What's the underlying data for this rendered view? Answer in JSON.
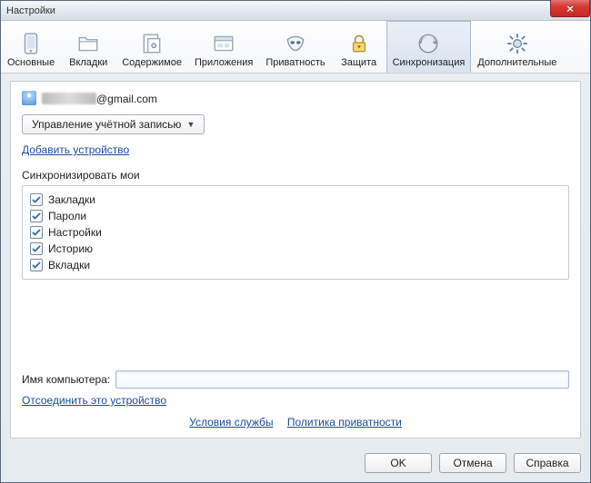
{
  "titlebar": {
    "title": "Настройки"
  },
  "tabs": [
    {
      "label": "Основные"
    },
    {
      "label": "Вкладки"
    },
    {
      "label": "Содержимое"
    },
    {
      "label": "Приложения"
    },
    {
      "label": "Приватность"
    },
    {
      "label": "Защита"
    },
    {
      "label": "Синхронизация"
    },
    {
      "label": "Дополнительные"
    }
  ],
  "account": {
    "email_suffix": "@gmail.com",
    "manage_button": "Управление учётной записью",
    "add_device_link": "Добавить устройство"
  },
  "sync": {
    "heading": "Синхронизировать мои",
    "items": [
      {
        "label": "Закладки",
        "checked": true
      },
      {
        "label": "Пароли",
        "checked": true
      },
      {
        "label": "Настройки",
        "checked": true
      },
      {
        "label": "Историю",
        "checked": true
      },
      {
        "label": "Вкладки",
        "checked": true
      }
    ]
  },
  "computer_name": {
    "label": "Имя компьютера:",
    "value": ""
  },
  "disconnect_link": "Отсоединить это устройство",
  "footer_links": {
    "tos": "Условия службы",
    "privacy": "Политика приватности"
  },
  "buttons": {
    "ok": "OK",
    "cancel": "Отмена",
    "help": "Справка"
  }
}
